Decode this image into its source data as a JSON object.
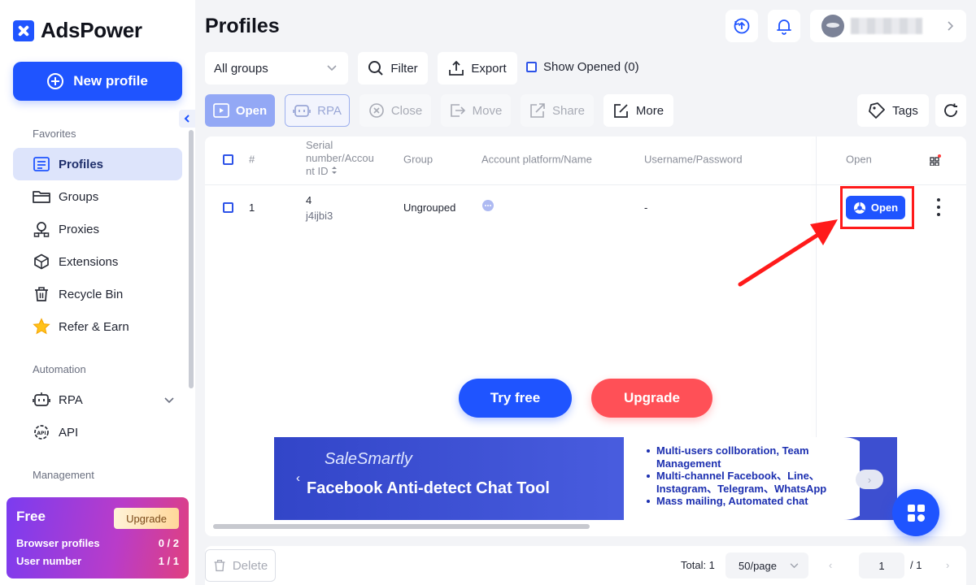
{
  "app": {
    "name": "AdsPower"
  },
  "sidebar": {
    "new_profile_label": "New profile",
    "sections": {
      "favorites": "Favorites",
      "automation": "Automation",
      "management": "Management"
    },
    "items": [
      {
        "label": "Profiles",
        "icon": "profiles-icon",
        "active": true
      },
      {
        "label": "Groups",
        "icon": "folder-icon"
      },
      {
        "label": "Proxies",
        "icon": "proxies-icon"
      },
      {
        "label": "Extensions",
        "icon": "cube-icon"
      },
      {
        "label": "Recycle Bin",
        "icon": "trash-icon"
      },
      {
        "label": "Refer & Earn",
        "icon": "star-icon"
      },
      {
        "label": "RPA",
        "icon": "robot-icon"
      },
      {
        "label": "API",
        "icon": "api-icon"
      }
    ],
    "plan": {
      "name": "Free",
      "upgrade_label": "Upgrade",
      "browser_profiles_label": "Browser profiles",
      "browser_profiles_value": "0 / 2",
      "user_number_label": "User number",
      "user_number_value": "1 / 1"
    }
  },
  "header": {
    "title": "Profiles"
  },
  "toolbar": {
    "group_select": "All groups",
    "filter_label": "Filter",
    "export_label": "Export",
    "show_opened_label": "Show Opened (0)"
  },
  "actions": {
    "open_label": "Open",
    "rpa_label": "RPA",
    "close_label": "Close",
    "move_label": "Move",
    "share_label": "Share",
    "more_label": "More",
    "tags_label": "Tags"
  },
  "table": {
    "columns": {
      "index": "#",
      "serial": "Serial number/Account ID",
      "serial_line1": "Serial",
      "serial_line2": "number/Accou",
      "serial_line3": "nt ID",
      "group": "Group",
      "platform": "Account platform/Name",
      "credentials": "Username/Password",
      "open": "Open"
    },
    "rows": [
      {
        "index": "1",
        "serial": "4",
        "account_id": "j4ijbi3",
        "group": "Ungrouped",
        "credentials": "-",
        "open_label": "Open"
      }
    ]
  },
  "cta": {
    "try_free": "Try free",
    "upgrade": "Upgrade"
  },
  "banner": {
    "brand": "SaleSmartly",
    "headline": "Facebook Anti-detect Chat Tool",
    "bullets": [
      "Multi-users collboration, Team",
      "Management",
      "Multi-channel Facebook、Line、",
      "Instagram、Telegram、WhatsApp",
      "Mass mailing, Automated chat"
    ]
  },
  "footer": {
    "delete_label": "Delete",
    "total": "Total: 1",
    "per_page": "50/page",
    "current_page": "1",
    "page_count": "/ 1"
  },
  "colors": {
    "primary": "#1f54ff",
    "danger": "#ff5057",
    "highlight": "#ff1a1a",
    "active_nav": "#dde4fb"
  }
}
